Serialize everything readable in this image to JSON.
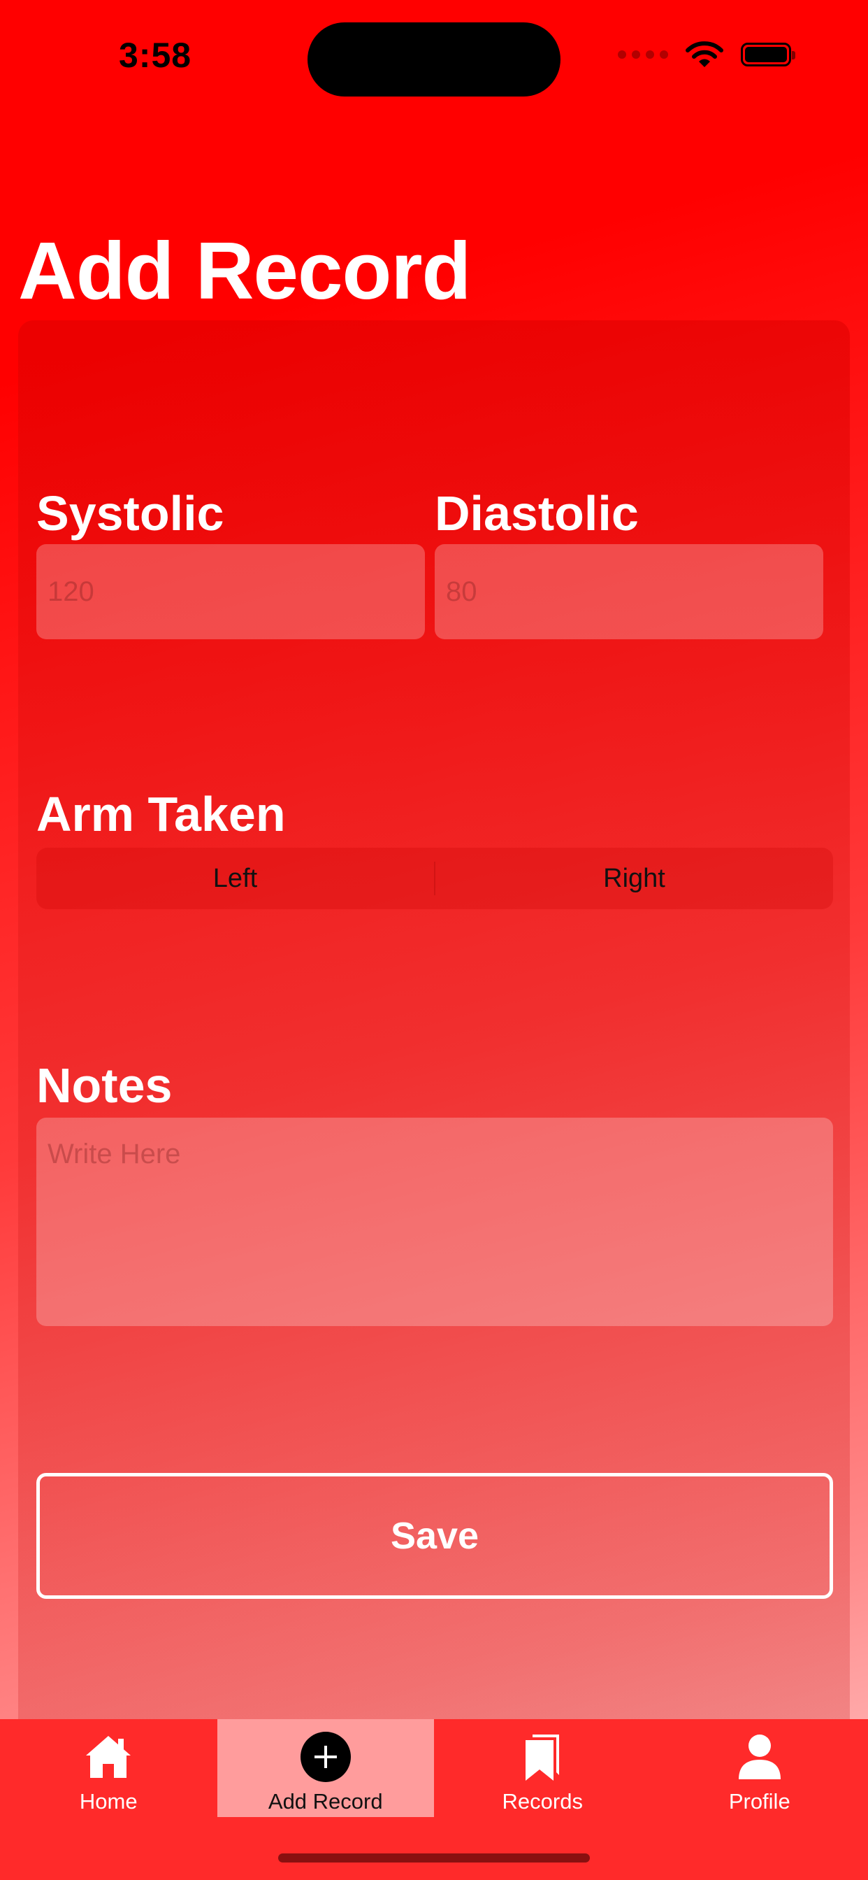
{
  "status_bar": {
    "time": "3:58"
  },
  "page": {
    "title": "Add Record"
  },
  "form": {
    "systolic": {
      "label": "Systolic",
      "placeholder": "120",
      "value": ""
    },
    "diastolic": {
      "label": "Diastolic",
      "placeholder": "80",
      "value": ""
    },
    "arm_taken": {
      "label": "Arm Taken",
      "options": [
        "Left",
        "Right"
      ]
    },
    "notes": {
      "label": "Notes",
      "placeholder": "Write Here",
      "value": ""
    },
    "save_label": "Save"
  },
  "tab_bar": {
    "active": "Add Record",
    "items": [
      {
        "label": "Home",
        "icon": "home-icon"
      },
      {
        "label": "Add Record",
        "icon": "plus-circle-icon"
      },
      {
        "label": "Records",
        "icon": "bookmarks-icon"
      },
      {
        "label": "Profile",
        "icon": "person-icon"
      }
    ]
  },
  "colors": {
    "background_top": "#ff0000",
    "tab_bar": "#ff2a2a",
    "tab_active": "#ff9c9c",
    "text_primary": "#ffffff"
  }
}
